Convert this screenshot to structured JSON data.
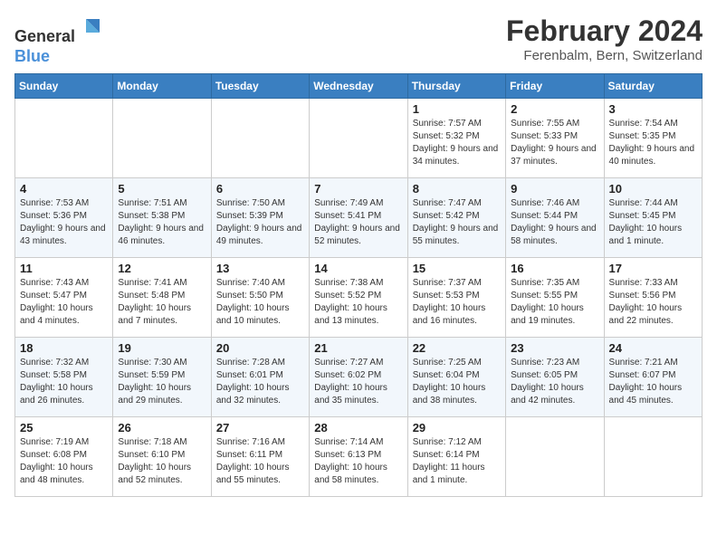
{
  "header": {
    "logo_line1": "General",
    "logo_line2": "Blue",
    "title": "February 2024",
    "subtitle": "Ferenbalm, Bern, Switzerland"
  },
  "weekdays": [
    "Sunday",
    "Monday",
    "Tuesday",
    "Wednesday",
    "Thursday",
    "Friday",
    "Saturday"
  ],
  "weeks": [
    [
      {
        "day": "",
        "sunrise": "",
        "sunset": "",
        "daylight": ""
      },
      {
        "day": "",
        "sunrise": "",
        "sunset": "",
        "daylight": ""
      },
      {
        "day": "",
        "sunrise": "",
        "sunset": "",
        "daylight": ""
      },
      {
        "day": "",
        "sunrise": "",
        "sunset": "",
        "daylight": ""
      },
      {
        "day": "1",
        "sunrise": "Sunrise: 7:57 AM",
        "sunset": "Sunset: 5:32 PM",
        "daylight": "Daylight: 9 hours and 34 minutes."
      },
      {
        "day": "2",
        "sunrise": "Sunrise: 7:55 AM",
        "sunset": "Sunset: 5:33 PM",
        "daylight": "Daylight: 9 hours and 37 minutes."
      },
      {
        "day": "3",
        "sunrise": "Sunrise: 7:54 AM",
        "sunset": "Sunset: 5:35 PM",
        "daylight": "Daylight: 9 hours and 40 minutes."
      }
    ],
    [
      {
        "day": "4",
        "sunrise": "Sunrise: 7:53 AM",
        "sunset": "Sunset: 5:36 PM",
        "daylight": "Daylight: 9 hours and 43 minutes."
      },
      {
        "day": "5",
        "sunrise": "Sunrise: 7:51 AM",
        "sunset": "Sunset: 5:38 PM",
        "daylight": "Daylight: 9 hours and 46 minutes."
      },
      {
        "day": "6",
        "sunrise": "Sunrise: 7:50 AM",
        "sunset": "Sunset: 5:39 PM",
        "daylight": "Daylight: 9 hours and 49 minutes."
      },
      {
        "day": "7",
        "sunrise": "Sunrise: 7:49 AM",
        "sunset": "Sunset: 5:41 PM",
        "daylight": "Daylight: 9 hours and 52 minutes."
      },
      {
        "day": "8",
        "sunrise": "Sunrise: 7:47 AM",
        "sunset": "Sunset: 5:42 PM",
        "daylight": "Daylight: 9 hours and 55 minutes."
      },
      {
        "day": "9",
        "sunrise": "Sunrise: 7:46 AM",
        "sunset": "Sunset: 5:44 PM",
        "daylight": "Daylight: 9 hours and 58 minutes."
      },
      {
        "day": "10",
        "sunrise": "Sunrise: 7:44 AM",
        "sunset": "Sunset: 5:45 PM",
        "daylight": "Daylight: 10 hours and 1 minute."
      }
    ],
    [
      {
        "day": "11",
        "sunrise": "Sunrise: 7:43 AM",
        "sunset": "Sunset: 5:47 PM",
        "daylight": "Daylight: 10 hours and 4 minutes."
      },
      {
        "day": "12",
        "sunrise": "Sunrise: 7:41 AM",
        "sunset": "Sunset: 5:48 PM",
        "daylight": "Daylight: 10 hours and 7 minutes."
      },
      {
        "day": "13",
        "sunrise": "Sunrise: 7:40 AM",
        "sunset": "Sunset: 5:50 PM",
        "daylight": "Daylight: 10 hours and 10 minutes."
      },
      {
        "day": "14",
        "sunrise": "Sunrise: 7:38 AM",
        "sunset": "Sunset: 5:52 PM",
        "daylight": "Daylight: 10 hours and 13 minutes."
      },
      {
        "day": "15",
        "sunrise": "Sunrise: 7:37 AM",
        "sunset": "Sunset: 5:53 PM",
        "daylight": "Daylight: 10 hours and 16 minutes."
      },
      {
        "day": "16",
        "sunrise": "Sunrise: 7:35 AM",
        "sunset": "Sunset: 5:55 PM",
        "daylight": "Daylight: 10 hours and 19 minutes."
      },
      {
        "day": "17",
        "sunrise": "Sunrise: 7:33 AM",
        "sunset": "Sunset: 5:56 PM",
        "daylight": "Daylight: 10 hours and 22 minutes."
      }
    ],
    [
      {
        "day": "18",
        "sunrise": "Sunrise: 7:32 AM",
        "sunset": "Sunset: 5:58 PM",
        "daylight": "Daylight: 10 hours and 26 minutes."
      },
      {
        "day": "19",
        "sunrise": "Sunrise: 7:30 AM",
        "sunset": "Sunset: 5:59 PM",
        "daylight": "Daylight: 10 hours and 29 minutes."
      },
      {
        "day": "20",
        "sunrise": "Sunrise: 7:28 AM",
        "sunset": "Sunset: 6:01 PM",
        "daylight": "Daylight: 10 hours and 32 minutes."
      },
      {
        "day": "21",
        "sunrise": "Sunrise: 7:27 AM",
        "sunset": "Sunset: 6:02 PM",
        "daylight": "Daylight: 10 hours and 35 minutes."
      },
      {
        "day": "22",
        "sunrise": "Sunrise: 7:25 AM",
        "sunset": "Sunset: 6:04 PM",
        "daylight": "Daylight: 10 hours and 38 minutes."
      },
      {
        "day": "23",
        "sunrise": "Sunrise: 7:23 AM",
        "sunset": "Sunset: 6:05 PM",
        "daylight": "Daylight: 10 hours and 42 minutes."
      },
      {
        "day": "24",
        "sunrise": "Sunrise: 7:21 AM",
        "sunset": "Sunset: 6:07 PM",
        "daylight": "Daylight: 10 hours and 45 minutes."
      }
    ],
    [
      {
        "day": "25",
        "sunrise": "Sunrise: 7:19 AM",
        "sunset": "Sunset: 6:08 PM",
        "daylight": "Daylight: 10 hours and 48 minutes."
      },
      {
        "day": "26",
        "sunrise": "Sunrise: 7:18 AM",
        "sunset": "Sunset: 6:10 PM",
        "daylight": "Daylight: 10 hours and 52 minutes."
      },
      {
        "day": "27",
        "sunrise": "Sunrise: 7:16 AM",
        "sunset": "Sunset: 6:11 PM",
        "daylight": "Daylight: 10 hours and 55 minutes."
      },
      {
        "day": "28",
        "sunrise": "Sunrise: 7:14 AM",
        "sunset": "Sunset: 6:13 PM",
        "daylight": "Daylight: 10 hours and 58 minutes."
      },
      {
        "day": "29",
        "sunrise": "Sunrise: 7:12 AM",
        "sunset": "Sunset: 6:14 PM",
        "daylight": "Daylight: 11 hours and 1 minute."
      },
      {
        "day": "",
        "sunrise": "",
        "sunset": "",
        "daylight": ""
      },
      {
        "day": "",
        "sunrise": "",
        "sunset": "",
        "daylight": ""
      }
    ]
  ]
}
